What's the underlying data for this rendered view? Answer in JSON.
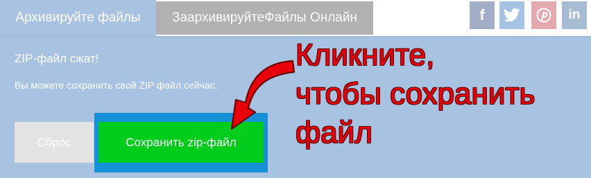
{
  "tabs": [
    {
      "label": "Архивируйте файлы",
      "active": true
    },
    {
      "label": "ЗаархивируйтеФайлы Онлайн",
      "active": false
    }
  ],
  "social": [
    {
      "icon": "facebook-icon",
      "glyph": "f",
      "color": "#a3aec6"
    },
    {
      "icon": "twitter-icon",
      "glyph": "",
      "color": "#a5c3e2"
    },
    {
      "icon": "pinterest-icon",
      "glyph": "",
      "color": "#e2a9ae"
    },
    {
      "icon": "linkedin-icon",
      "glyph": "in",
      "color": "#a5bcd2"
    }
  ],
  "message": {
    "title": "ZIP-файл сжат!",
    "subtitle": "Вы можете сохранить свой ZIP файл сейчас."
  },
  "buttons": {
    "reset_label": "Сброс",
    "save_label": "Сохранить zip-файл"
  },
  "callout": {
    "line1": "Кликните,",
    "line2": "чтобы сохранить",
    "line3": "файл"
  },
  "colors": {
    "panel": "#a7c3e1",
    "save_button": "#00cc1b",
    "save_frame": "#1691d7",
    "callout_text": "#e8000b"
  }
}
